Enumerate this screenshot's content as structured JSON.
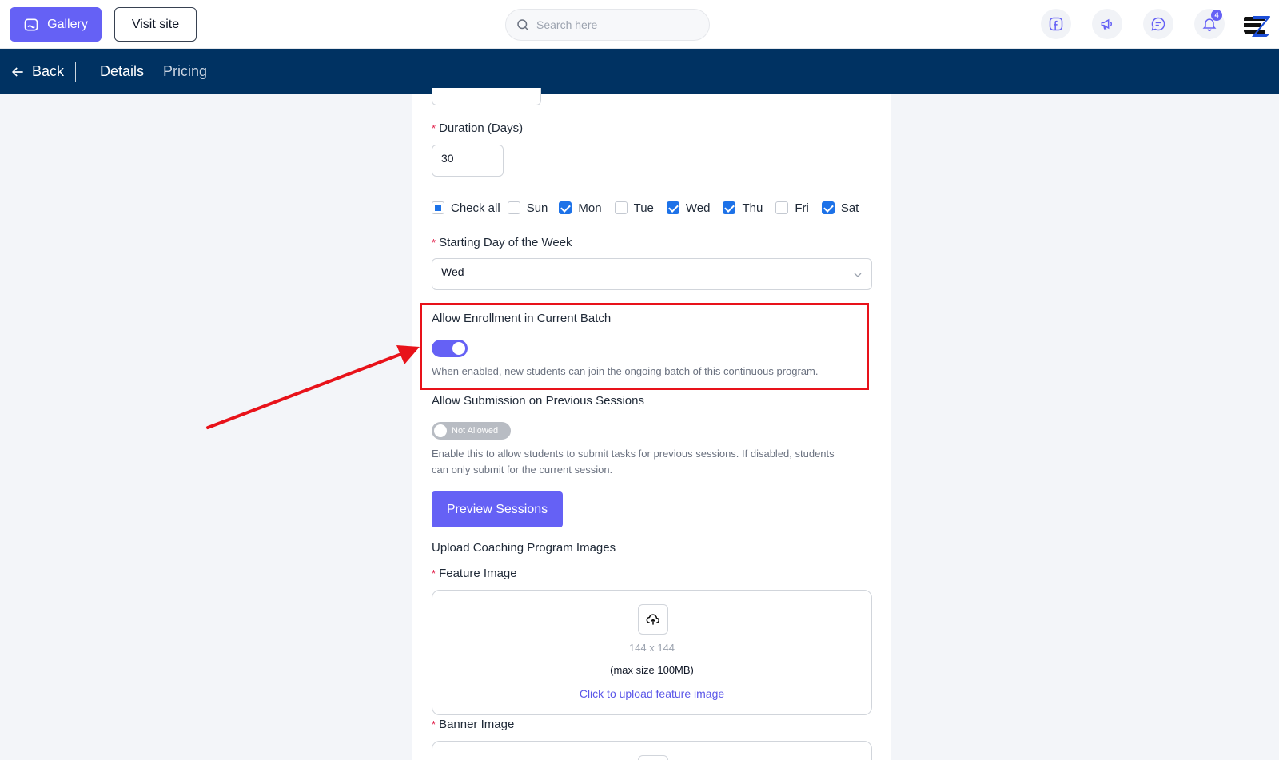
{
  "topbar": {
    "gallery_label": "Gallery",
    "visit_label": "Visit site",
    "search_placeholder": "Search here",
    "notification_count": "4"
  },
  "navbar": {
    "back_label": "Back",
    "tabs": [
      {
        "label": "Details",
        "active": true
      },
      {
        "label": "Pricing",
        "active": false
      }
    ]
  },
  "form": {
    "duration_label": "Duration (Days)",
    "duration_value": "30",
    "check_all_label": "Check all",
    "days": [
      {
        "label": "Sun",
        "checked": false
      },
      {
        "label": "Mon",
        "checked": true
      },
      {
        "label": "Tue",
        "checked": false
      },
      {
        "label": "Wed",
        "checked": true
      },
      {
        "label": "Thu",
        "checked": true
      },
      {
        "label": "Fri",
        "checked": false
      },
      {
        "label": "Sat",
        "checked": true
      }
    ],
    "starting_day_label": "Starting Day of the Week",
    "starting_day_value": "Wed",
    "allow_enrollment_label": "Allow Enrollment in Current Batch",
    "allow_enrollment_help": "When enabled, new students can join the ongoing batch of this continuous program.",
    "allow_submission_label": "Allow Submission on Previous Sessions",
    "allow_submission_toggle_text": "Not Allowed",
    "allow_submission_help_1": "Enable this to allow students to submit tasks for previous sessions. If disabled, students",
    "allow_submission_help_2": "can only submit for the current session.",
    "preview_button": "Preview Sessions",
    "upload_section_title": "Upload Coaching Program Images",
    "feature_image_label": "Feature Image",
    "feature_size": "144 x 144",
    "feature_max": "(max size 100MB)",
    "feature_upload_link": "Click to upload feature image",
    "banner_image_label": "Banner Image"
  },
  "colors": {
    "accent": "#6561f5",
    "navbar": "#003262",
    "highlight": "#e8121a",
    "checkbox": "#1d72e8"
  }
}
